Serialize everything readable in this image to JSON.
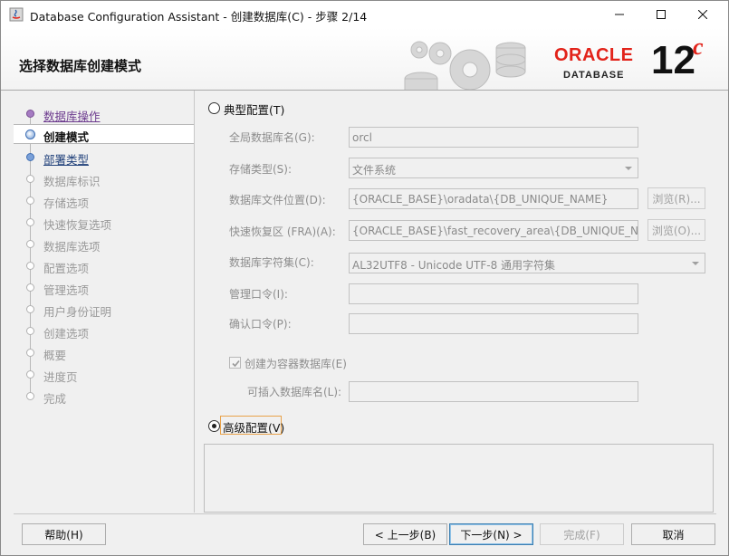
{
  "window": {
    "title": "Database Configuration Assistant - 创建数据库(C) - 步骤 2/14",
    "controls": [
      "minimize-icon",
      "maximize-icon",
      "close-icon"
    ]
  },
  "header": {
    "title": "选择数据库创建模式",
    "logo": {
      "word": "ORACLE",
      "sub": "DATABASE",
      "version": "12",
      "suffix": "c"
    }
  },
  "steps": [
    {
      "label": "数据库操作",
      "state": "done"
    },
    {
      "label": "创建模式",
      "state": "current"
    },
    {
      "label": "部署类型",
      "state": "next"
    },
    {
      "label": "数据库标识",
      "state": "pending"
    },
    {
      "label": "存储选项",
      "state": "pending"
    },
    {
      "label": "快速恢复选项",
      "state": "pending"
    },
    {
      "label": "数据库选项",
      "state": "pending"
    },
    {
      "label": "配置选项",
      "state": "pending"
    },
    {
      "label": "管理选项",
      "state": "pending"
    },
    {
      "label": "用户身份证明",
      "state": "pending"
    },
    {
      "label": "创建选项",
      "state": "pending"
    },
    {
      "label": "概要",
      "state": "pending"
    },
    {
      "label": "进度页",
      "state": "pending"
    },
    {
      "label": "完成",
      "state": "pending"
    }
  ],
  "typical": {
    "label": "典型配置(T)",
    "selected": false,
    "fields": {
      "global_db_name": {
        "label": "全局数据库名(G):",
        "value": "orcl"
      },
      "storage_type": {
        "label": "存储类型(S):",
        "value": "文件系统"
      },
      "db_file_location": {
        "label": "数据库文件位置(D):",
        "value": "{ORACLE_BASE}\\oradata\\{DB_UNIQUE_NAME}",
        "browse": "浏览(R)..."
      },
      "fra": {
        "label": "快速恢复区 (FRA)(A):",
        "value": "{ORACLE_BASE}\\fast_recovery_area\\{DB_UNIQUE_NAME}",
        "browse": "浏览(O)..."
      },
      "charset": {
        "label": "数据库字符集(C):",
        "value": "AL32UTF8 - Unicode UTF-8 通用字符集"
      },
      "admin_password": {
        "label": "管理口令(I):",
        "value": ""
      },
      "confirm_password": {
        "label": "确认口令(P):",
        "value": ""
      },
      "container_db": {
        "label": "创建为容器数据库(E)",
        "checked": true
      },
      "pdb_name": {
        "label": "可插入数据库名(L):",
        "value": ""
      }
    }
  },
  "advanced": {
    "label": "高级配置(V)",
    "selected": true
  },
  "footer": {
    "help": "帮助(H)",
    "back": "< 上一步(B)",
    "next": "下一步(N) >",
    "finish": "完成(F)",
    "cancel": "取消"
  }
}
